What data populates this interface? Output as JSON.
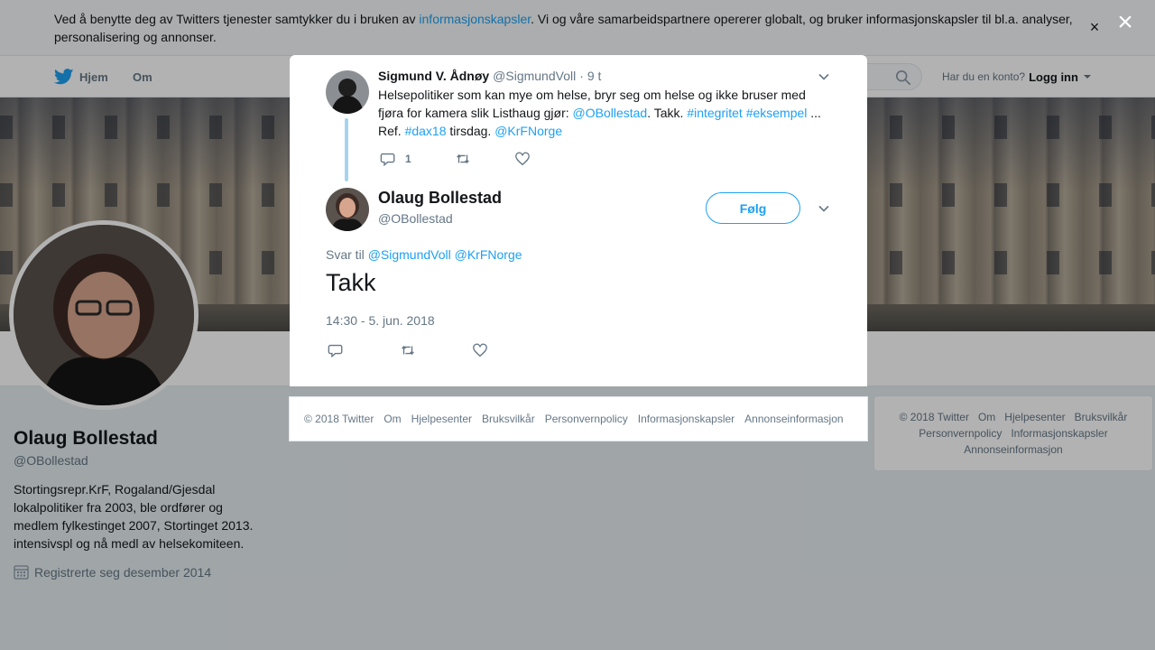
{
  "cookie_banner": {
    "text_before": "Ved å benytte deg av Twitters tjenester samtykker du i bruken av ",
    "link": "informasjonskapsler",
    "text_after": ". Vi og våre samarbeidspartnere opererer globalt, og bruker informasjonskapsler til bl.a. analyser, personalisering og annonser.",
    "close": "×"
  },
  "nav": {
    "home": "Hjem",
    "about": "Om",
    "login_prompt": "Har du en konto?",
    "login": "Logg inn"
  },
  "profile": {
    "name": "Olaug Bollestad",
    "handle": "@OBollestad",
    "bio": "Stortingsrepr.KrF, Rogaland/Gjesdal lokalpolitiker fra 2003, ble ordfører og medlem fylkestinget 2007, Stortinget 2013. intensivspl og nå medl av helsekomiteen.",
    "joined": "Registrerte seg desember 2014"
  },
  "right_footer": {
    "items": [
      "© 2018 Twitter",
      "Om",
      "Hjelpesenter",
      "Bruksvilkår",
      "Personvernpolicy",
      "Informasjonskapsler",
      "Annonseinformasjon"
    ]
  },
  "overlay": {
    "close": "×"
  },
  "parent_tweet": {
    "name": "Sigmund V. Ådnøy",
    "handle": "@SigmundVoll",
    "sep": "·",
    "time": "9 t",
    "text_1": "Helsepolitiker som kan mye om helse, bryr seg om helse og ikke bruser med fjøra for kamera slik Listhaug gjør: ",
    "mention_1": "@OBollestad",
    "text_2": ". Takk. ",
    "hashtag_1": "#integritet",
    "hashtag_2": "#eksempel",
    "text_3": " ... Ref. ",
    "hashtag_3": "#dax18",
    "text_4": " tirsdag. ",
    "mention_2": "@KrFNorge",
    "reply_count": "1"
  },
  "main_tweet": {
    "name": "Olaug Bollestad",
    "handle": "@OBollestad",
    "follow": "Følg",
    "reply_label": "Svar til",
    "reply_mention_1": "@SigmundVoll",
    "reply_mention_2": "@KrFNorge",
    "text": "Takk",
    "timestamp": "14:30 - 5. jun. 2018"
  },
  "modal_footer": {
    "items": [
      "© 2018 Twitter",
      "Om",
      "Hjelpesenter",
      "Bruksvilkår",
      "Personvernpolicy",
      "Informasjonskapsler",
      "Annonseinformasjon"
    ]
  },
  "colors": {
    "accent": "#1da1f2",
    "thread_line": "#a5d3f0",
    "secondary_text": "#657786"
  }
}
